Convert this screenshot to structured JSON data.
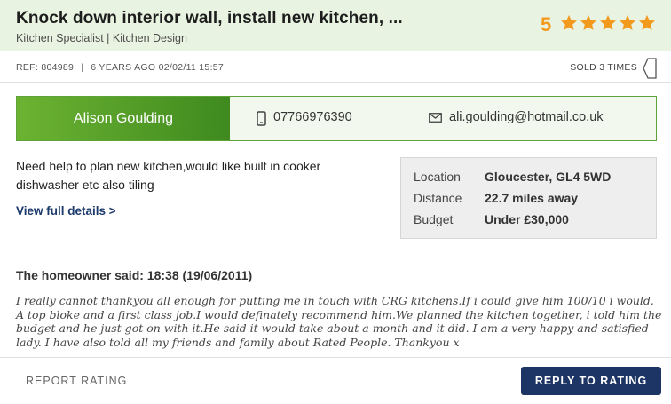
{
  "job": {
    "title": "Knock down interior wall, install new kitchen, ...",
    "categories": "Kitchen Specialist | Kitchen Design"
  },
  "rating": {
    "score": "5",
    "stars": 5,
    "star_color": "#f39a1d"
  },
  "meta": {
    "ref": "REF: 804989",
    "separator": "|",
    "age": "6 YEARS AGO 02/02/11 15:57",
    "sold": "SOLD 3 TIMES"
  },
  "contact": {
    "name": "Alison Goulding",
    "phone": "07766976390",
    "email": "ali.goulding@hotmail.co.uk",
    "accent": "#5ea23a"
  },
  "description": "Need help to plan new kitchen,would like built in cooker dishwasher etc also tiling",
  "view_details": "View full details >",
  "details": {
    "location_label": "Location",
    "location_value": "Gloucester, GL4 5WD",
    "distance_label": "Distance",
    "distance_value": "22.7 miles away",
    "budget_label": "Budget",
    "budget_value": "Under £30,000"
  },
  "review": {
    "heading": "The homeowner said: 18:38 (19/06/2011)",
    "text": "I really cannot thankyou all enough for putting me in touch with CRG kitchens.If i could give him 100/10 i would. A top bloke and a first class job.I would definately recommend him.We planned the kitchen together, i told him the budget and he just got on with it.He said it would take about a month and it did. I am a very happy and satisfied lady. I have also told all my friends and family about Rated People. Thankyou x"
  },
  "actions": {
    "report": "REPORT RATING",
    "reply": "REPLY TO RATING",
    "reply_color": "#1d3564"
  }
}
